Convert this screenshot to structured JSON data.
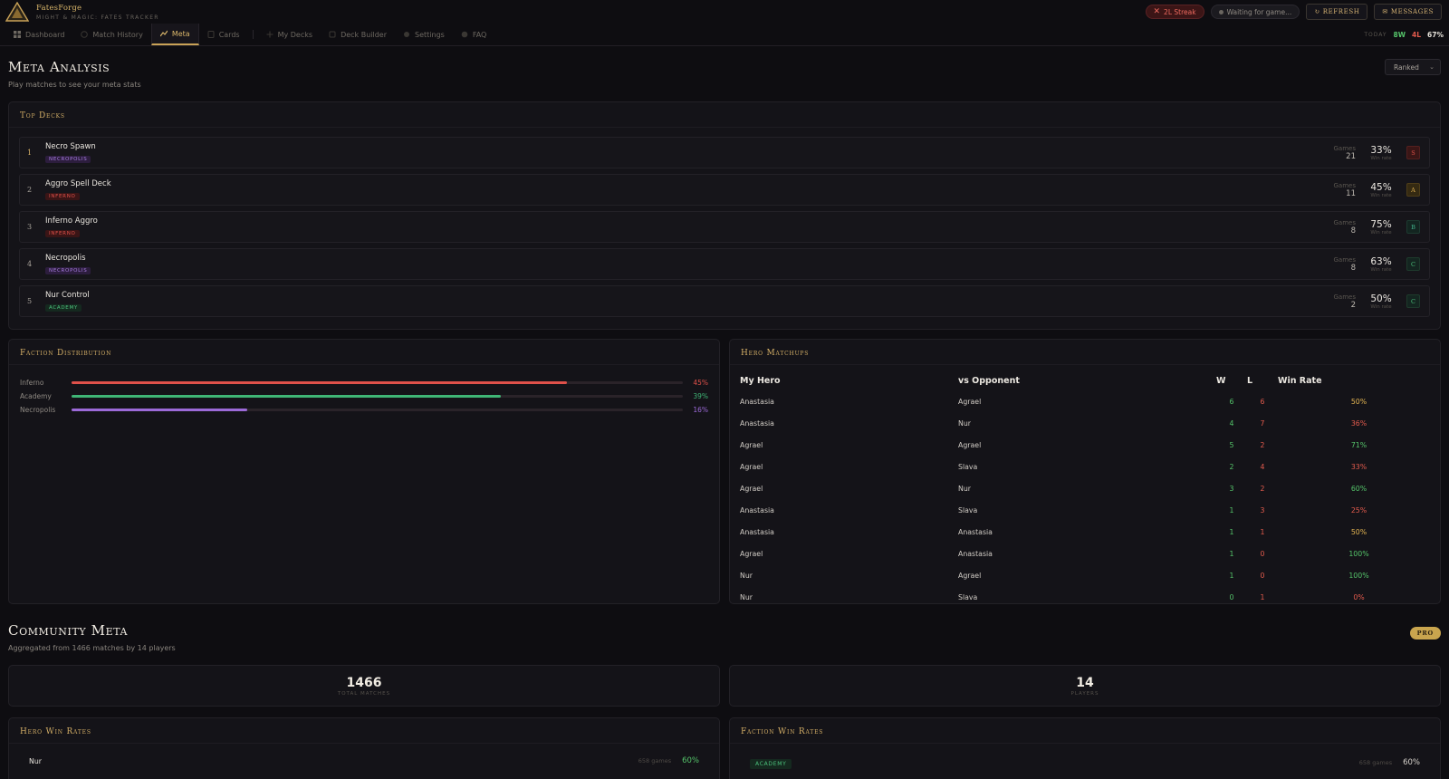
{
  "app": {
    "title": "FatesForge",
    "subtitle": "MIGHT & MAGIC: FATES TRACKER"
  },
  "topbar": {
    "streak": "2L Streak",
    "status": "Waiting for game...",
    "refresh_label": "REFRESH",
    "messages_label": "MESSAGES"
  },
  "nav": {
    "items": [
      {
        "label": "Dashboard",
        "icon": "grid-icon"
      },
      {
        "label": "Match History",
        "icon": "clock-icon"
      },
      {
        "label": "Meta",
        "icon": "chart-icon",
        "active": true
      },
      {
        "label": "Cards",
        "icon": "card-icon"
      },
      {
        "label": "My Decks",
        "icon": "plus-icon"
      },
      {
        "label": "Deck Builder",
        "icon": "build-icon"
      },
      {
        "label": "Settings",
        "icon": "gear-icon"
      },
      {
        "label": "FAQ",
        "icon": "help-icon"
      }
    ],
    "today": {
      "label": "TODAY",
      "wins": "8W",
      "losses": "4L",
      "rate": "67%"
    }
  },
  "meta": {
    "title": "Meta Analysis",
    "subtitle": "Play matches to see your meta stats",
    "filter_value": "Ranked",
    "top_decks": {
      "title": "Top Decks",
      "games_label": "Games",
      "winrate_label": "Win rate",
      "rows": [
        {
          "rank": "1",
          "name": "Necro Spawn",
          "faction": "NECROPOLIS",
          "faction_key": "necropolis",
          "games": "21",
          "winrate": "33%",
          "grade": "S"
        },
        {
          "rank": "2",
          "name": "Aggro Spell Deck",
          "faction": "INFERNO",
          "faction_key": "inferno",
          "games": "11",
          "winrate": "45%",
          "grade": "A"
        },
        {
          "rank": "3",
          "name": "Inferno Aggro",
          "faction": "INFERNO",
          "faction_key": "inferno",
          "games": "8",
          "winrate": "75%",
          "grade": "B"
        },
        {
          "rank": "4",
          "name": "Necropolis",
          "faction": "NECROPOLIS",
          "faction_key": "necropolis",
          "games": "8",
          "winrate": "63%",
          "grade": "C"
        },
        {
          "rank": "5",
          "name": "Nur Control",
          "faction": "ACADEMY",
          "faction_key": "academy",
          "games": "2",
          "winrate": "50%",
          "grade": "C"
        }
      ]
    },
    "faction_distribution": {
      "title": "Faction Distribution",
      "rows": [
        {
          "name": "Inferno",
          "percent": "45%",
          "value": 0.45,
          "color": "#e0514a"
        },
        {
          "name": "Academy",
          "percent": "39%",
          "value": 0.39,
          "color": "#3fb575"
        },
        {
          "name": "Necropolis",
          "percent": "16%",
          "value": 0.16,
          "color": "#9c6ad8"
        }
      ]
    },
    "hero_matchups": {
      "title": "Hero Matchups",
      "headers": [
        "My Hero",
        "vs Opponent",
        "W",
        "L",
        "Win Rate"
      ],
      "rows": [
        {
          "hero": "Anastasia",
          "opponent": "Agrael",
          "w": "6",
          "l": "6",
          "rate": "50%"
        },
        {
          "hero": "Anastasia",
          "opponent": "Nur",
          "w": "4",
          "l": "7",
          "rate": "36%"
        },
        {
          "hero": "Agrael",
          "opponent": "Agrael",
          "w": "5",
          "l": "2",
          "rate": "71%"
        },
        {
          "hero": "Agrael",
          "opponent": "Slava",
          "w": "2",
          "l": "4",
          "rate": "33%"
        },
        {
          "hero": "Agrael",
          "opponent": "Nur",
          "w": "3",
          "l": "2",
          "rate": "60%"
        },
        {
          "hero": "Anastasia",
          "opponent": "Slava",
          "w": "1",
          "l": "3",
          "rate": "25%"
        },
        {
          "hero": "Anastasia",
          "opponent": "Anastasia",
          "w": "1",
          "l": "1",
          "rate": "50%"
        },
        {
          "hero": "Agrael",
          "opponent": "Anastasia",
          "w": "1",
          "l": "0",
          "rate": "100%"
        },
        {
          "hero": "Nur",
          "opponent": "Agrael",
          "w": "1",
          "l": "0",
          "rate": "100%"
        },
        {
          "hero": "Nur",
          "opponent": "Slava",
          "w": "0",
          "l": "1",
          "rate": "0%"
        }
      ]
    }
  },
  "community": {
    "title": "Community Meta",
    "subtitle": "Aggregated from 1466 matches by 14 players",
    "badge": "PRO",
    "total_matches": {
      "value": "1466",
      "label": "TOTAL MATCHES"
    },
    "players": {
      "value": "14",
      "label": "PLAYERS"
    },
    "hero_win_rates": {
      "title": "Hero Win Rates",
      "rows": [
        {
          "name": "Nur",
          "games": "658 games",
          "rate": "60%"
        }
      ]
    },
    "faction_win_rates": {
      "title": "Faction Win Rates",
      "rows": [
        {
          "name": "ACADEMY",
          "games": "658 games",
          "rate": "60%"
        }
      ]
    }
  },
  "colors": {
    "accent_gold": "#d3ae66",
    "win_green": "#55c46a",
    "loss_red": "#e35b4d",
    "mid_amber": "#e3b452"
  }
}
